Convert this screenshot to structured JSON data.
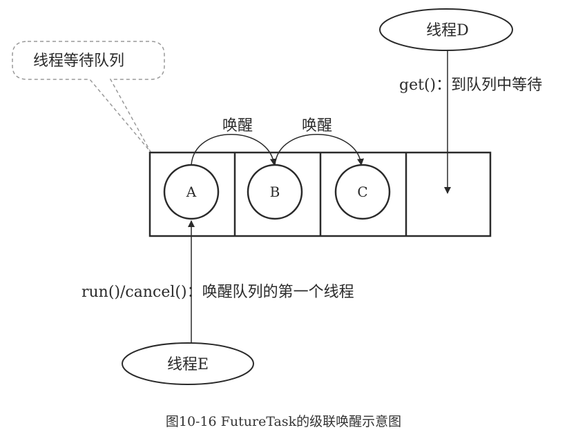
{
  "diagram": {
    "bubble_label": "线程等待队列",
    "thread_d_label": "线程D",
    "thread_e_label": "线程E",
    "get_label": "get()：到队列中等待",
    "wake_label_1": "唤醒",
    "wake_label_2": "唤醒",
    "node_a": "A",
    "node_b": "B",
    "node_c": "C",
    "run_label": "run()/cancel()：唤醒队列的第一个线程"
  },
  "caption": "图10-16  FutureTask的级联唤醒示意图"
}
